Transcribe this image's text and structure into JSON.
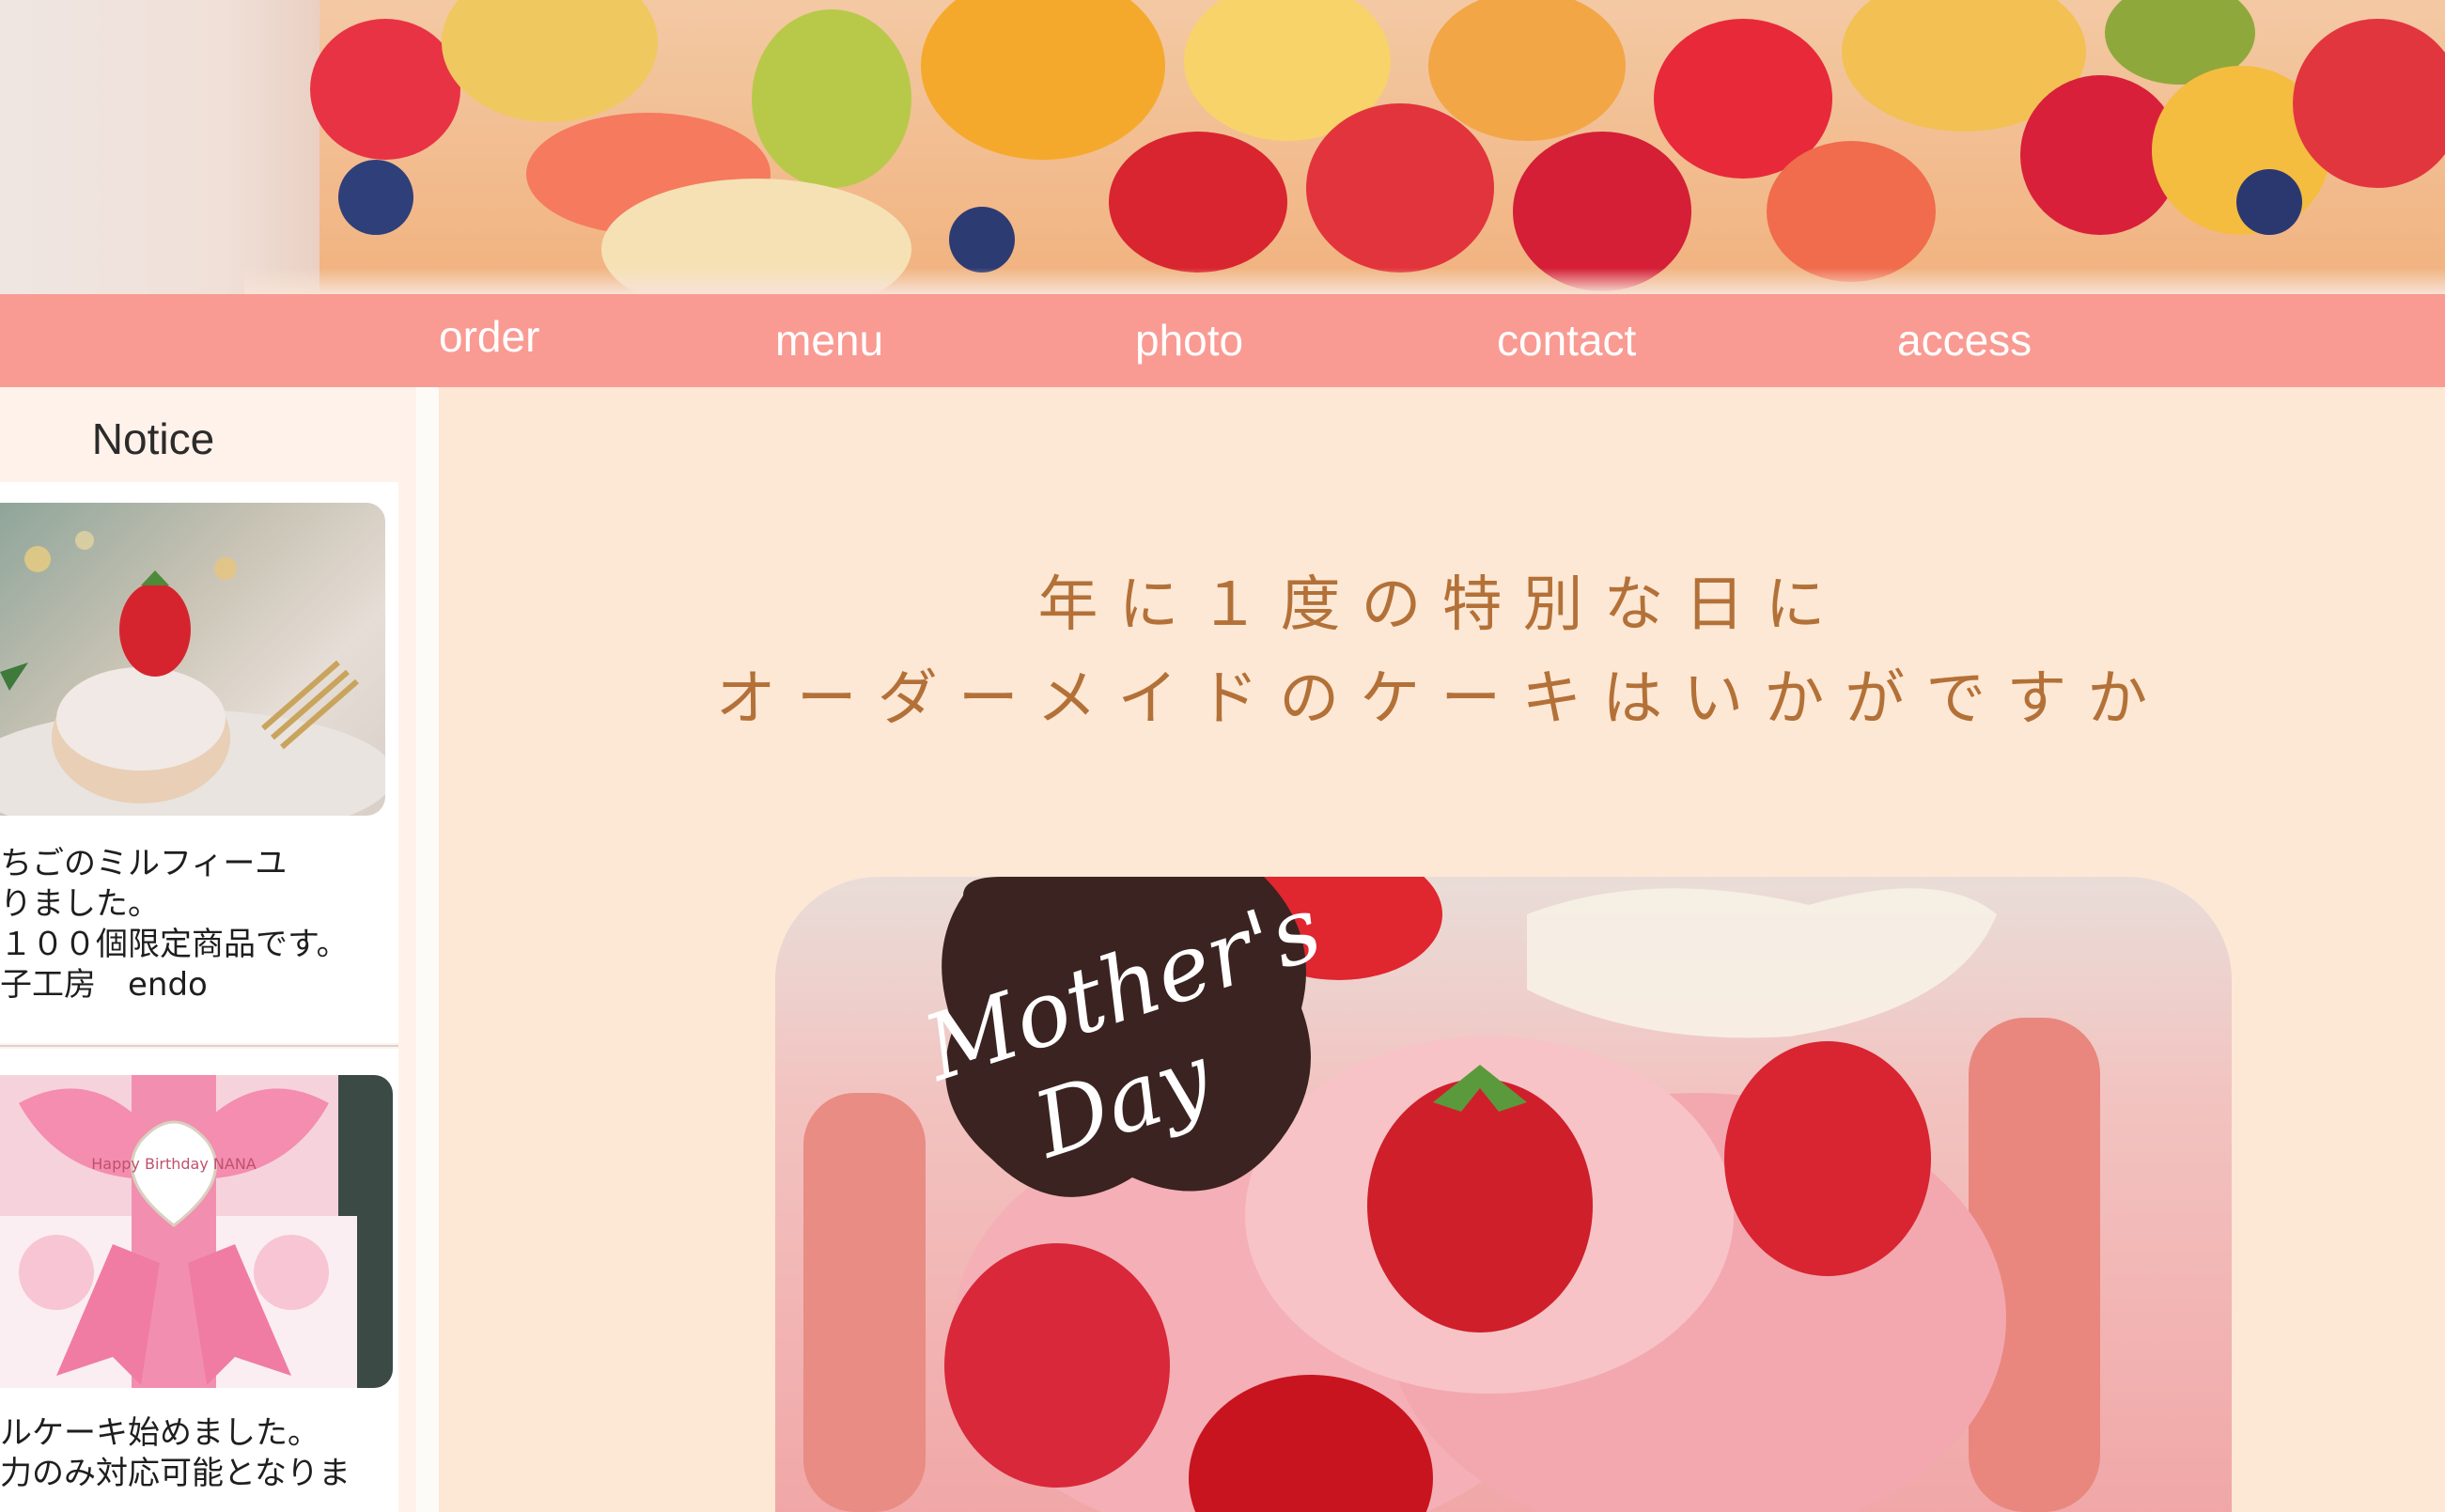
{
  "nav": {
    "items": [
      {
        "label": "order"
      },
      {
        "label": "menu"
      },
      {
        "label": "photo"
      },
      {
        "label": "contact"
      },
      {
        "label": "access"
      }
    ]
  },
  "sidebar": {
    "title": "Notice",
    "posts": [
      {
        "image_icon": "strawberry-millefeuille-photo-icon",
        "lines": [
          "ちごのミルフィーユ",
          "りました。",
          "１００個限定商品です。",
          "子工房　endo"
        ]
      },
      {
        "image_icon": "ribbon-birthday-cake-photo-icon",
        "image_caption": "Happy Birthday NANA",
        "lines": [
          "ルケーキ始めました。",
          "力のみ対応可能となりま"
        ]
      }
    ]
  },
  "main": {
    "heading_line1": "年に１度の特別な日に",
    "heading_line2": "オーダーメイドのケーキはいかがですか",
    "cake_plaque_text": "Mother's Day"
  },
  "colors": {
    "nav_bg": "#f99b93",
    "page_bg": "#fde8d5",
    "heading": "#b37138",
    "sidebar_bg": "#fff2ea"
  }
}
